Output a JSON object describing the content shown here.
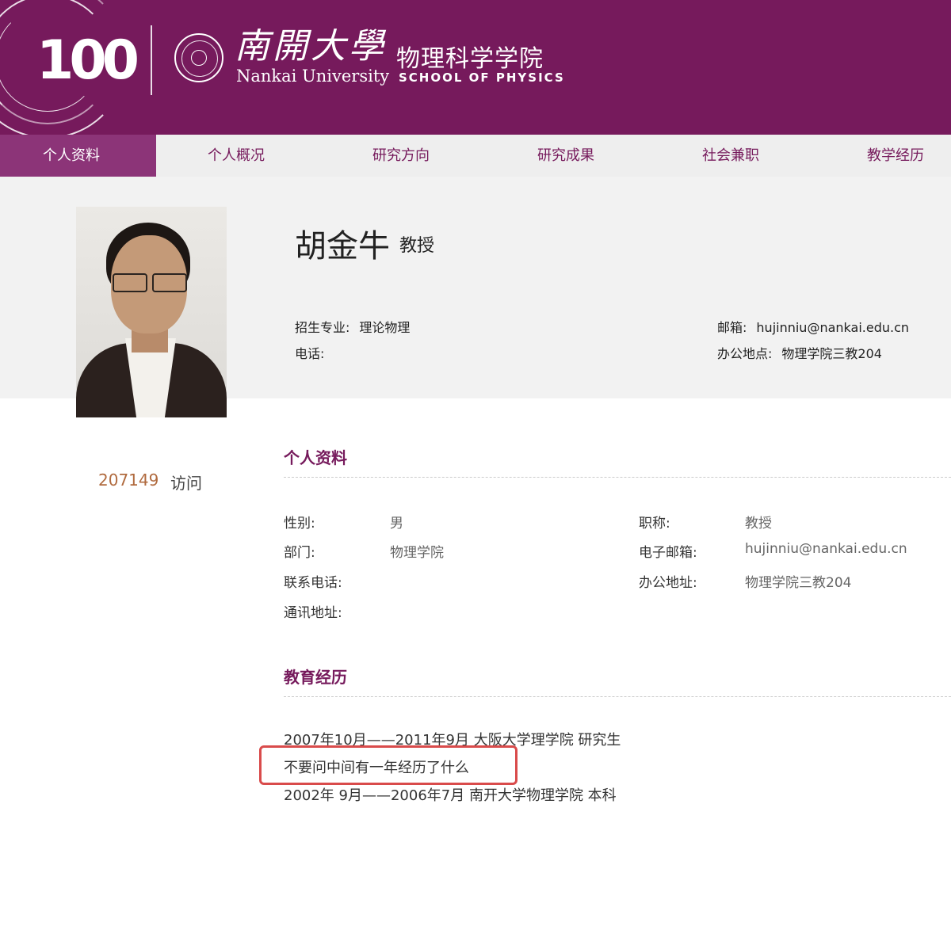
{
  "header": {
    "centennial_logo": "100",
    "university_cn": "南開大學",
    "university_en": "Nankai University",
    "school_cn": "物理科学学院",
    "school_en": "SCHOOL OF PHYSICS",
    "bg_color": "#761a5c"
  },
  "nav": {
    "items": [
      {
        "label": "个人资料",
        "active": true
      },
      {
        "label": "个人概况",
        "active": false
      },
      {
        "label": "研究方向",
        "active": false
      },
      {
        "label": "研究成果",
        "active": false
      },
      {
        "label": "社会兼职",
        "active": false
      },
      {
        "label": "教学经历",
        "active": false
      }
    ]
  },
  "profile": {
    "name": "胡金牛",
    "title": "教授",
    "major_label": "招生专业:",
    "major_value": "理论物理",
    "phone_label": "电话:",
    "phone_value": "",
    "email_label": "邮箱:",
    "email_value": "hujinniu@nankai.edu.cn",
    "office_label": "办公地点:",
    "office_value": "物理学院三教204"
  },
  "visits": {
    "count": "207149",
    "label": "访问"
  },
  "personal_info": {
    "section_title": "个人资料",
    "gender_label": "性别:",
    "gender_value": "男",
    "position_label": "职称:",
    "position_value": "教授",
    "dept_label": "部门:",
    "dept_value": "物理学院",
    "email_label": "电子邮箱:",
    "email_value": "hujinniu@nankai.edu.cn",
    "phone_label": "联系电话:",
    "phone_value": "",
    "office_label": "办公地址:",
    "office_value": "物理学院三教204",
    "mail_label": "通讯地址:",
    "mail_value": ""
  },
  "education": {
    "section_title": "教育经历",
    "entries": [
      "2007年10月——2011年9月 大阪大学理学院 研究生",
      "不要问中间有一年经历了什么",
      "2002年 9月——2006年7月 南开大学物理学院 本科"
    ],
    "highlight_color": "#d94b4b"
  }
}
